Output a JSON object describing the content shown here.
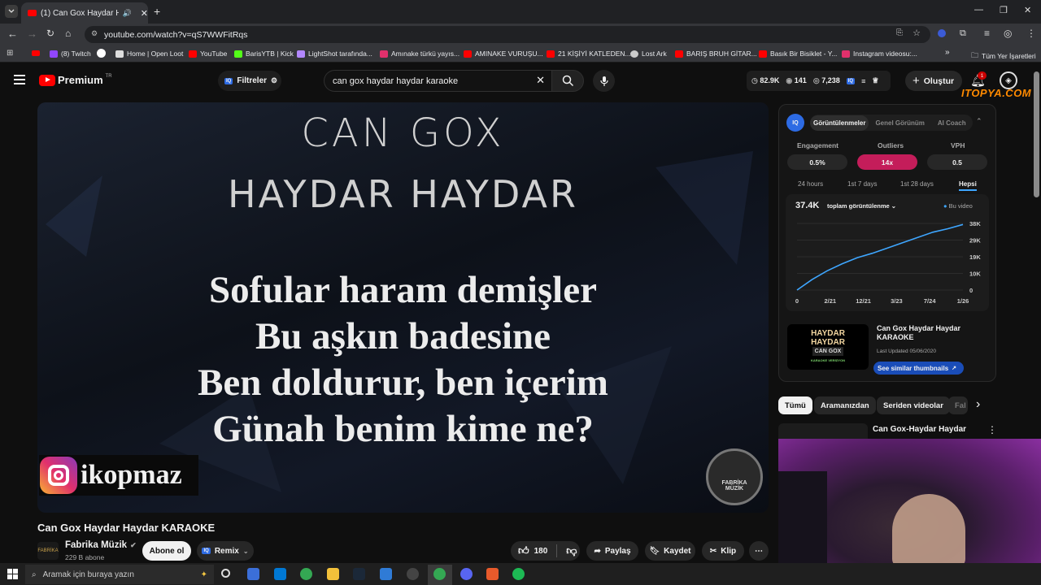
{
  "browser": {
    "tab_title": "(1) Can Gox Haydar Hayda",
    "url": "youtube.com/watch?v=qS7WWFitRqs",
    "bookmarks": [
      "(8) Twitch",
      "Home | Open Loot",
      "YouTube",
      "BarisYTB | Kick",
      "LightShot tarafında...",
      "Amınake türkü yayıs...",
      "AMINAKE VURUŞU...",
      "21 KİŞİYİ KATLEDEN...",
      "Lost Ark",
      "BARIŞ BRUH GİTAR...",
      "Basık Bir Bisiklet - Y...",
      "Instagram videosu:..."
    ],
    "all_bookmarks": "Tüm Yer İşaretleri"
  },
  "header": {
    "logo": "Premium",
    "logo_badge": "TR",
    "filters": "Filtreler",
    "search_value": "can gox haydar haydar karaoke",
    "stats": [
      "82.9K",
      "141",
      "7,238"
    ],
    "create": "Oluştur",
    "notif_count": "1",
    "watermark": "ITOPYA.COM"
  },
  "video": {
    "title_line1": "CAN GOX",
    "title_line2": "HAYDAR HAYDAR",
    "lyrics": [
      "Sofular haram demişler",
      "Bu aşkın badesine",
      "Ben doldurur, ben içerim",
      "Günah benim kime ne?"
    ],
    "insta_handle": "ikopmaz",
    "logo_text": [
      "FABRİKA",
      "MÜZİK"
    ]
  },
  "panel": {
    "tabs": [
      "Görüntülenmeler",
      "Genel Görünüm",
      "AI Coach"
    ],
    "metrics": [
      {
        "label": "Engagement",
        "value": "0.5%"
      },
      {
        "label": "Outliers",
        "value": "14x"
      },
      {
        "label": "VPH",
        "value": "0.5"
      }
    ],
    "ranges": [
      "24 hours",
      "1st 7 days",
      "1st 28 days",
      "Hepsi"
    ],
    "chart_total": "37.4K",
    "chart_dropdown": "toplam görüntülenme",
    "legend": "Bu video",
    "thumb_title": "Can Gox Haydar Haydar KARAOKE",
    "thumb_updated": "Last Updated 05/06/2020",
    "thumb_text": [
      "HAYDAR",
      "HAYDAR",
      "CAN GOX",
      "KARAOKE VERSİYON"
    ],
    "similar_btn": "See similar thumbnails"
  },
  "chart_data": {
    "type": "line",
    "x": [
      "0",
      "2/21",
      "12/21",
      "3/23",
      "7/24",
      "1/26"
    ],
    "y_ticks": [
      "38K",
      "29K",
      "19K",
      "10K",
      "0"
    ],
    "ylim": [
      0,
      38000
    ],
    "series": [
      {
        "name": "Bu video",
        "values": [
          0,
          6000,
          11000,
          15000,
          18500,
          21000,
          24000,
          27000,
          30000,
          33000,
          35000,
          37400
        ]
      }
    ]
  },
  "chips": [
    "Tümü",
    "Aramanızdan",
    "Seriden videolar",
    "Fal"
  ],
  "related": {
    "title": "Can Gox-Haydar Haydar"
  },
  "below": {
    "title": "Can Gox Haydar Haydar KARAOKE",
    "channel": "Fabrika Müzik",
    "subs": "229 B abone",
    "subscribe": "Abone ol",
    "remix": "Remix",
    "likes": "180",
    "share": "Paylaş",
    "save": "Kaydet",
    "clip": "Klip"
  },
  "taskbar": {
    "search_placeholder": "Aramak için buraya yazın"
  },
  "colors": {
    "accent": "#3ea6ff",
    "red": "#ff0000",
    "outlier": "#c41d5a",
    "panel": "#151515"
  }
}
